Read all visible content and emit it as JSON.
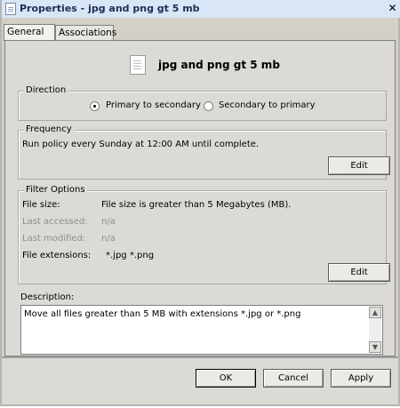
{
  "window": {
    "title": "Properties - jpg and png gt 5 mb",
    "close_glyph": "✕"
  },
  "tabs": [
    {
      "label": "General",
      "active": true
    },
    {
      "label": "Associations",
      "active": false
    }
  ],
  "policy_name": "jpg and png gt 5 mb",
  "direction": {
    "legend": "Direction",
    "options": [
      {
        "label": "Primary to secondary",
        "selected": true
      },
      {
        "label": "Secondary to primary",
        "selected": false
      }
    ]
  },
  "frequency": {
    "legend": "Frequency",
    "text": "Run policy every Sunday at 12:00 AM until complete.",
    "edit_label": "Edit"
  },
  "filter": {
    "legend": "Filter Options",
    "rows": [
      {
        "label": "File size:",
        "value": "File size is greater than 5 Megabytes (MB).",
        "enabled": true
      },
      {
        "label": "Last accessed:",
        "value": "n/a",
        "enabled": false
      },
      {
        "label": "Last modified:",
        "value": "n/a",
        "enabled": false
      },
      {
        "label": "File extensions:",
        "value": "*.jpg *.png",
        "enabled": true
      }
    ],
    "edit_label": "Edit"
  },
  "description": {
    "label": "Description:",
    "value": "Move all files greater than 5 MB with extensions *.jpg or *.png"
  },
  "buttons": {
    "ok": "OK",
    "cancel": "Cancel",
    "apply": "Apply"
  },
  "icons": {
    "scroll_up": "▲",
    "scroll_down": "▼"
  }
}
